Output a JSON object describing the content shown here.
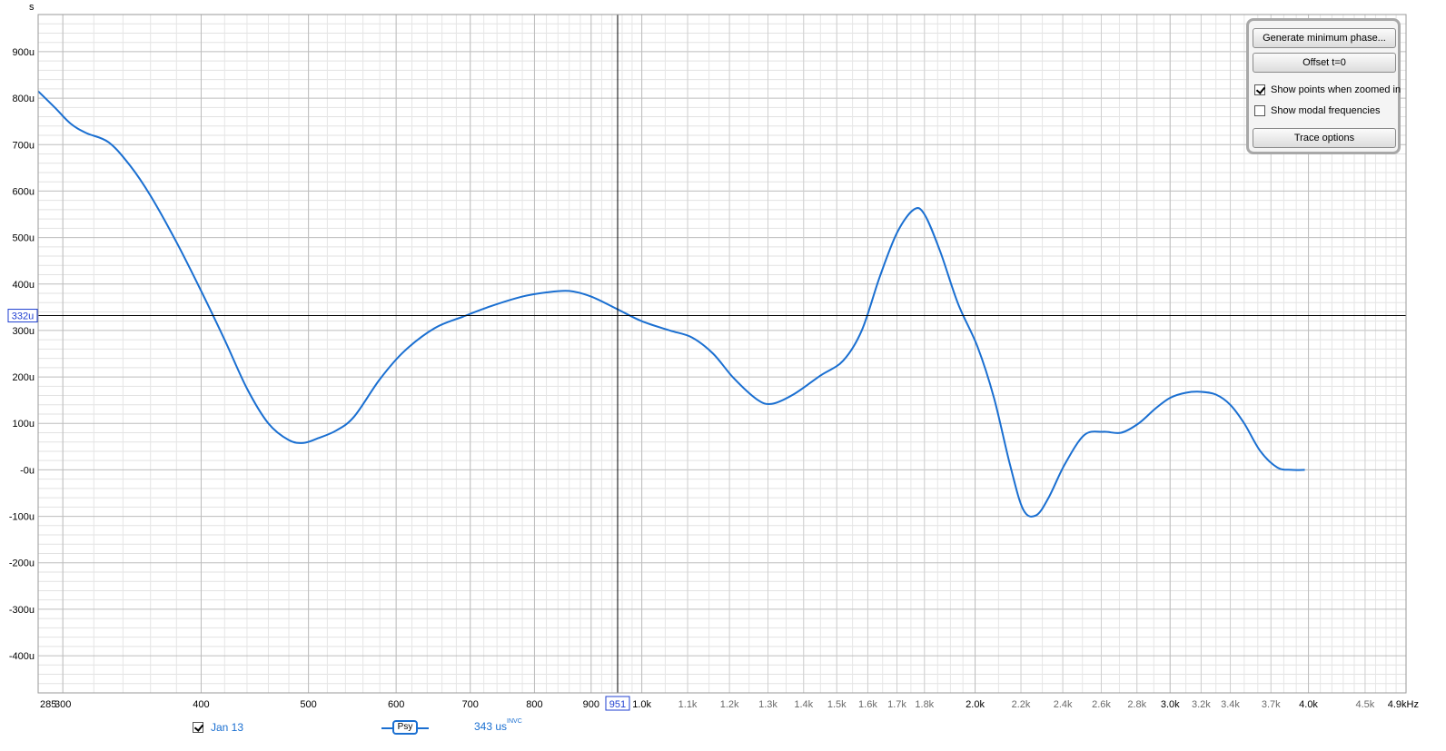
{
  "axis": {
    "y_unit": "s",
    "x_unit_suffix": "kHz"
  },
  "chart_data": {
    "type": "line",
    "title": "",
    "xlabel": "",
    "ylabel": "s",
    "x_scale": "log",
    "xlim": [
      285,
      4900
    ],
    "ylim": [
      -480,
      980
    ],
    "grid": true,
    "y_ticks": [
      {
        "v": 900,
        "label": "900u"
      },
      {
        "v": 800,
        "label": "800u"
      },
      {
        "v": 700,
        "label": "700u"
      },
      {
        "v": 600,
        "label": "600u"
      },
      {
        "v": 500,
        "label": "500u"
      },
      {
        "v": 400,
        "label": "400u"
      },
      {
        "v": 300,
        "label": "300u"
      },
      {
        "v": 200,
        "label": "200u"
      },
      {
        "v": 100,
        "label": "100u"
      },
      {
        "v": 0,
        "label": "-0u"
      },
      {
        "v": -100,
        "label": "-100u"
      },
      {
        "v": -200,
        "label": "-200u"
      },
      {
        "v": -300,
        "label": "-300u"
      },
      {
        "v": -400,
        "label": "-400u"
      }
    ],
    "x_ticks": [
      {
        "v": 285,
        "label": "285",
        "major": true
      },
      {
        "v": 300,
        "label": "300",
        "major": true
      },
      {
        "v": 400,
        "label": "400",
        "major": true
      },
      {
        "v": 500,
        "label": "500",
        "major": true
      },
      {
        "v": 600,
        "label": "600",
        "major": true
      },
      {
        "v": 700,
        "label": "700",
        "major": true
      },
      {
        "v": 800,
        "label": "800",
        "major": true
      },
      {
        "v": 900,
        "label": "900",
        "major": true
      },
      {
        "v": 1000,
        "label": "1.0k",
        "major": true
      },
      {
        "v": 1100,
        "label": "1.1k",
        "major": false
      },
      {
        "v": 1200,
        "label": "1.2k",
        "major": false
      },
      {
        "v": 1300,
        "label": "1.3k",
        "major": false
      },
      {
        "v": 1400,
        "label": "1.4k",
        "major": false
      },
      {
        "v": 1500,
        "label": "1.5k",
        "major": false
      },
      {
        "v": 1600,
        "label": "1.6k",
        "major": false
      },
      {
        "v": 1700,
        "label": "1.7k",
        "major": false
      },
      {
        "v": 1800,
        "label": "1.8k",
        "major": false
      },
      {
        "v": 2000,
        "label": "2.0k",
        "major": true
      },
      {
        "v": 2200,
        "label": "2.2k",
        "major": false
      },
      {
        "v": 2400,
        "label": "2.4k",
        "major": false
      },
      {
        "v": 2600,
        "label": "2.6k",
        "major": false
      },
      {
        "v": 2800,
        "label": "2.8k",
        "major": false
      },
      {
        "v": 3000,
        "label": "3.0k",
        "major": true
      },
      {
        "v": 3200,
        "label": "3.2k",
        "major": false
      },
      {
        "v": 3400,
        "label": "3.4k",
        "major": false
      },
      {
        "v": 3700,
        "label": "3.7k",
        "major": false
      },
      {
        "v": 4000,
        "label": "4.0k",
        "major": true
      },
      {
        "v": 4500,
        "label": "4.5k",
        "major": false
      },
      {
        "v": 4900,
        "label": "4.9kHz",
        "major": true
      }
    ],
    "cursor": {
      "x": 951,
      "x_label": "951",
      "y": 332,
      "y_label": "332u"
    },
    "series": [
      {
        "name": "Jan 13",
        "color": "#1a6fd1",
        "x": [
          285,
          295,
          305,
          315,
          330,
          345,
          360,
          380,
          400,
          420,
          440,
          460,
          480,
          495,
          510,
          530,
          550,
          580,
          610,
          650,
          690,
          730,
          780,
          820,
          860,
          900,
          950,
          1000,
          1060,
          1110,
          1160,
          1210,
          1270,
          1310,
          1370,
          1450,
          1520,
          1580,
          1640,
          1700,
          1760,
          1800,
          1860,
          1930,
          2010,
          2080,
          2150,
          2210,
          2270,
          2330,
          2410,
          2510,
          2610,
          2710,
          2810,
          2910,
          3000,
          3100,
          3200,
          3300,
          3400,
          3500,
          3620,
          3750,
          3860,
          3970
        ],
        "y": [
          815,
          780,
          745,
          725,
          705,
          655,
          590,
          490,
          385,
          280,
          175,
          100,
          64,
          58,
          68,
          85,
          115,
          195,
          255,
          305,
          330,
          352,
          373,
          382,
          385,
          373,
          346,
          320,
          300,
          285,
          250,
          198,
          152,
          142,
          162,
          203,
          235,
          300,
          415,
          510,
          560,
          550,
          470,
          358,
          265,
          155,
          12,
          -85,
          -98,
          -60,
          12,
          75,
          82,
          80,
          100,
          132,
          155,
          166,
          168,
          162,
          140,
          100,
          40,
          5,
          0,
          0
        ]
      }
    ]
  },
  "panel": {
    "buttons": {
      "min_phase": "Generate minimum phase...",
      "offset": "Offset t=0",
      "trace": "Trace options"
    },
    "checkboxes": {
      "show_points": "Show points when zoomed in",
      "show_modal": "Show modal frequencies"
    },
    "show_points_checked": true,
    "show_modal_checked": false
  },
  "legend": {
    "checked": true,
    "name": "Jan 13",
    "smoothing": "Psy",
    "value": "343 us",
    "value_sup": "INVC"
  }
}
